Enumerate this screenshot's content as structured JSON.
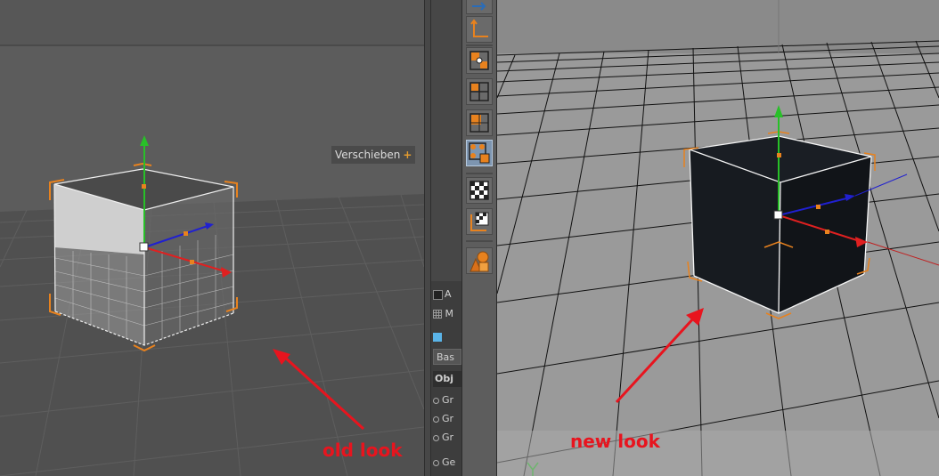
{
  "left_viewport": {
    "hud_label": "Verschieben",
    "hud_icon": "+",
    "annotation": "old look"
  },
  "attributes_panel": {
    "row_mode": "A",
    "row_grid": "M",
    "tab_basic": "Bas",
    "tab_object": "Obj",
    "items": [
      "Gr",
      "Gr",
      "Gr",
      "Ge"
    ]
  },
  "toolbar": {
    "icons": [
      "move-arrow-icon",
      "axis-corner-icon",
      "model-mode-icon",
      "polygon-grid-icon",
      "object-mode-icon",
      "texture-mode-icon",
      "checker-icon",
      "checker-axis-icon",
      "primitives-icon"
    ]
  },
  "right_viewport": {
    "annotation": "new look"
  },
  "colors": {
    "annotation": "#e8141e",
    "selection": "#e8821e",
    "axis_x": "#e02020",
    "axis_y": "#28c028",
    "axis_z": "#2020d0",
    "toolbar_active": "#7d95b0"
  }
}
